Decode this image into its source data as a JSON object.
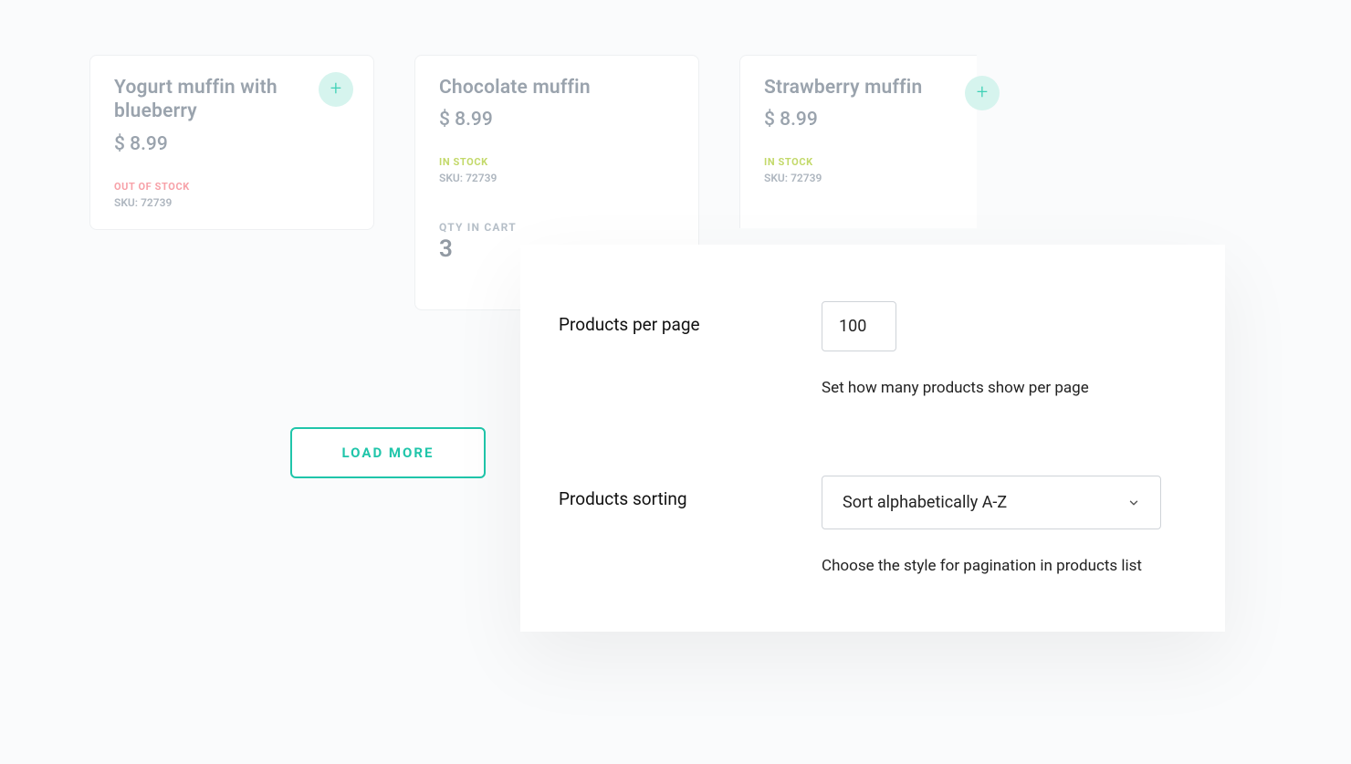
{
  "products": [
    {
      "title": "Yogurt muffin with blueberry",
      "price": "$ 8.99",
      "stockStatus": "OUT OF STOCK",
      "sku": "SKU: 72739"
    },
    {
      "title": "Chocolate muffin",
      "price": "$ 8.99",
      "stockStatus": "IN STOCK",
      "sku": "SKU: 72739",
      "qtyLabel": "QTY IN CART",
      "qtyValue": "3"
    },
    {
      "title": "Strawberry muffin",
      "price": "$ 8.99",
      "stockStatus": "IN STOCK",
      "sku": "SKU: 72739"
    }
  ],
  "loadMoreLabel": "LOAD MORE",
  "settings": {
    "perPage": {
      "label": "Products per page",
      "value": "100",
      "help": "Set how many products show per page"
    },
    "sorting": {
      "label": "Products sorting",
      "value": "Sort alphabetically A-Z",
      "help": "Choose the style for pagination in products list"
    }
  }
}
